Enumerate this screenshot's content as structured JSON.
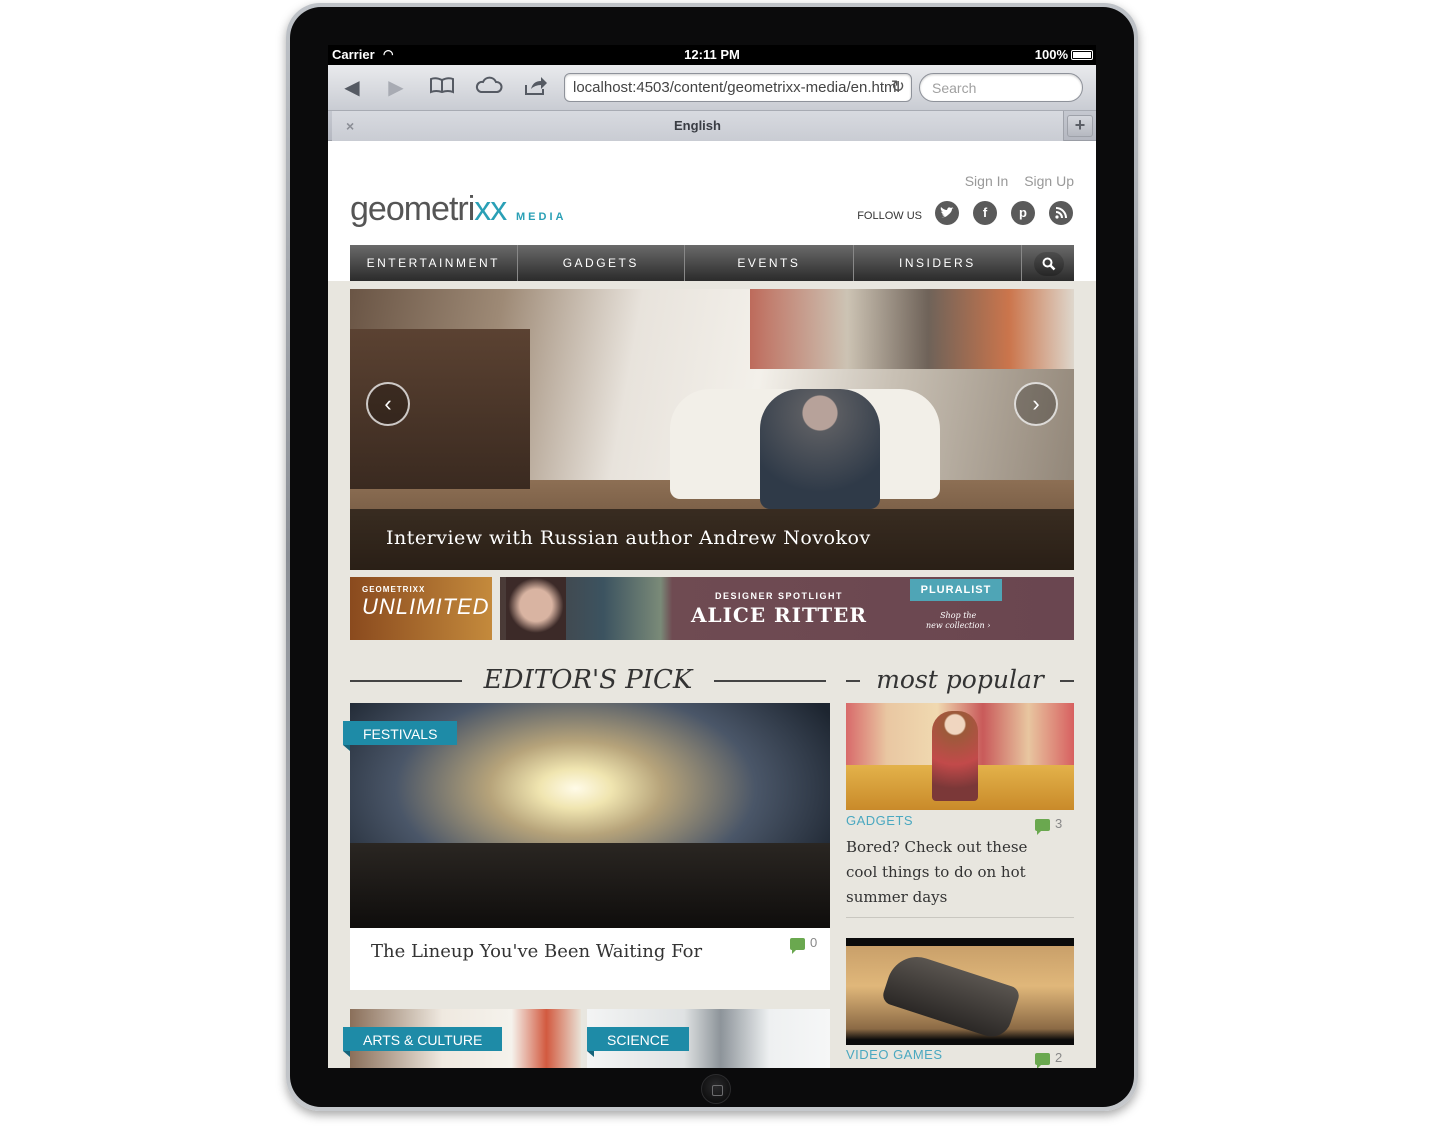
{
  "status_bar": {
    "carrier": "Carrier",
    "time": "12:11 PM",
    "battery": "100%"
  },
  "browser": {
    "url": "localhost:4503/content/geometrixx-media/en.html",
    "search_placeholder": "Search",
    "tab_title": "English",
    "tab_close": "×",
    "tab_add": "+"
  },
  "site": {
    "logo_text": "geometri",
    "logo_accent": "xx",
    "logo_sub": "MEDIA",
    "sign_in": "Sign In",
    "sign_up": "Sign Up",
    "follow_us": "FOLLOW US",
    "nav": [
      "ENTERTAINMENT",
      "GADGETS",
      "EVENTS",
      "INSIDERS"
    ],
    "accent_color": "#2aa0b6"
  },
  "hero": {
    "caption": "Interview with Russian author Andrew Novokov"
  },
  "banners": {
    "unlimited_small": "GEOMETRIXX",
    "unlimited_big": "UNLIMITED",
    "alice_kicker": "DESIGNER SPOTLIGHT",
    "alice_name": "ALICE RITTER",
    "pluralist": "PLURALIST",
    "pluralist_sub": "Shop the",
    "pluralist_sub2": "new collection ›"
  },
  "editors_pick": {
    "heading": "EDITOR'S PICK",
    "feature": {
      "tag": "FESTIVALS",
      "title": "The Lineup You've Been Waiting For",
      "comments": "0"
    },
    "thumbs": [
      {
        "tag": "ARTS & CULTURE"
      },
      {
        "tag": "SCIENCE"
      }
    ]
  },
  "most_popular": {
    "heading": "most popular",
    "items": [
      {
        "category": "GADGETS",
        "comments": "3",
        "title": "Bored? Check out these cool things to do on hot summer days"
      },
      {
        "category": "VIDEO GAMES",
        "comments": "2"
      }
    ]
  }
}
